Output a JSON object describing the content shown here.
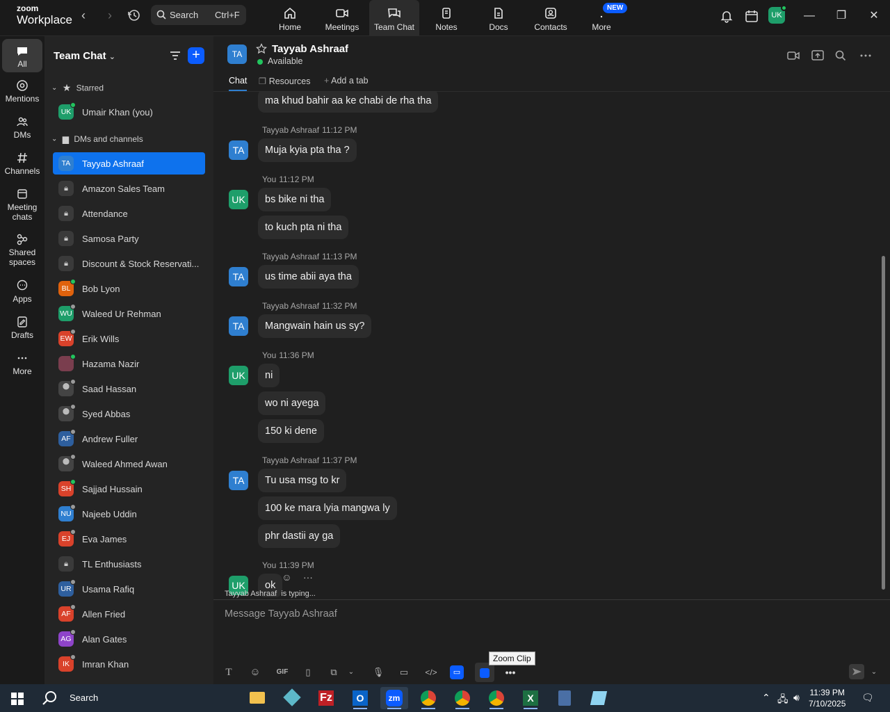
{
  "topbar": {
    "logo_small": "zoom",
    "logo_big": "Workplace",
    "search_label": "Search",
    "search_shortcut": "Ctrl+F",
    "tabs": [
      {
        "label": "Home",
        "icon": "home-icon"
      },
      {
        "label": "Meetings",
        "icon": "video-icon"
      },
      {
        "label": "Team Chat",
        "icon": "chat-icon"
      },
      {
        "label": "Notes",
        "icon": "notes-icon"
      },
      {
        "label": "Docs",
        "icon": "docs-icon"
      },
      {
        "label": "Contacts",
        "icon": "contacts-icon"
      },
      {
        "label": "More",
        "icon": "more-icon",
        "badge": "NEW"
      }
    ],
    "user_initials": "UK"
  },
  "rail": {
    "items": [
      {
        "label": "All"
      },
      {
        "label": "Mentions"
      },
      {
        "label": "DMs"
      },
      {
        "label": "Channels"
      },
      {
        "label": "Meeting chats"
      },
      {
        "label": "Shared spaces"
      },
      {
        "label": "Apps"
      },
      {
        "label": "Drafts"
      },
      {
        "label": "More"
      }
    ]
  },
  "sidebar": {
    "title": "Team Chat",
    "starred_label": "Starred",
    "starred": [
      {
        "initials": "UK",
        "name": "Umair Khan (you)",
        "color": "#1e9e6a",
        "status": "#22c55e"
      }
    ],
    "dms_label": "DMs and channels",
    "items": [
      {
        "initials": "TA",
        "name": "Tayyab Ashraaf",
        "color": "#2f7fd0",
        "status": "",
        "active": true
      },
      {
        "initials": "",
        "name": "Amazon Sales Team",
        "kind": "lock"
      },
      {
        "initials": "",
        "name": "Attendance",
        "kind": "lock"
      },
      {
        "initials": "",
        "name": "Samosa Party",
        "kind": "lock"
      },
      {
        "initials": "",
        "name": "Discount & Stock Reservati...",
        "kind": "lock"
      },
      {
        "initials": "BL",
        "name": "Bob Lyon",
        "color": "#e0620d",
        "status": "#22c55e"
      },
      {
        "initials": "WU",
        "name": "Waleed Ur Rehman",
        "color": "#1e9e6a",
        "status": "#9a9a9a"
      },
      {
        "initials": "EW",
        "name": "Erik Wills",
        "color": "#d9422b",
        "status": "#9a9a9a"
      },
      {
        "initials": "",
        "name": "Hazama Nazir",
        "kind": "photo",
        "color": "#7a3e4e",
        "status": "#22c55e"
      },
      {
        "initials": "",
        "name": "Saad Hassan",
        "kind": "photo",
        "status": "#9a9a9a"
      },
      {
        "initials": "",
        "name": "Syed Abbas",
        "kind": "photo",
        "status": "#9a9a9a"
      },
      {
        "initials": "AF",
        "name": "Andrew Fuller",
        "color": "#2e5f9e",
        "status": "#9a9a9a"
      },
      {
        "initials": "",
        "name": "Waleed Ahmed Awan",
        "kind": "photo",
        "status": "#9a9a9a"
      },
      {
        "initials": "SH",
        "name": "Sajjad Hussain",
        "color": "#d9422b",
        "status": "#22c55e"
      },
      {
        "initials": "NU",
        "name": "Najeeb Uddin",
        "color": "#2f7fd0",
        "status": "#9a9a9a"
      },
      {
        "initials": "EJ",
        "name": "Eva James",
        "color": "#d9422b",
        "status": "#9a9a9a"
      },
      {
        "initials": "",
        "name": "TL Enthusiasts",
        "kind": "lock"
      },
      {
        "initials": "UR",
        "name": "Usama Rafiq",
        "color": "#2e5f9e",
        "status": "#9a9a9a"
      },
      {
        "initials": "AF",
        "name": "Allen Fried",
        "color": "#d9422b",
        "status": "#9a9a9a"
      },
      {
        "initials": "AG",
        "name": "Alan Gates",
        "color": "#8e44c9",
        "status": "#9a9a9a"
      },
      {
        "initials": "IK",
        "name": "Imran Khan",
        "color": "#d9422b",
        "status": "#9a9a9a"
      }
    ]
  },
  "chat": {
    "avatar_initials": "TA",
    "name": "Tayyab Ashraaf",
    "status": "Available",
    "tabs": [
      "Chat",
      "Resources",
      "Add a tab"
    ],
    "messages": [
      {
        "text": "ma khud bahir aa ke chabi de rha tha",
        "sender": "",
        "time": "",
        "avatar": ""
      },
      {
        "text": "Muja kyia pta tha ?",
        "sender": "Tayyab Ashraaf",
        "time": "11:12 PM",
        "avatar": "TA"
      },
      {
        "text": "bs bike ni tha",
        "sender": "You",
        "time": "11:12 PM",
        "avatar": "UK"
      },
      {
        "text": "to kuch pta ni tha",
        "sender": "",
        "time": "",
        "avatar": ""
      },
      {
        "text": "us time abii aya tha",
        "sender": "Tayyab Ashraaf",
        "time": "11:13 PM",
        "avatar": "TA"
      },
      {
        "text": "Mangwain hain us sy?",
        "sender": "Tayyab Ashraaf",
        "time": "11:32 PM",
        "avatar": "TA"
      },
      {
        "text": "ni",
        "sender": "You",
        "time": "11:36 PM",
        "avatar": "UK"
      },
      {
        "text": "wo ni ayega",
        "sender": "",
        "time": "",
        "avatar": ""
      },
      {
        "text": "150 ki dene",
        "sender": "",
        "time": "",
        "avatar": ""
      },
      {
        "text": "Tu usa msg to kr",
        "sender": "Tayyab Ashraaf",
        "time": "11:37 PM",
        "avatar": "TA"
      },
      {
        "text": "100 ke mara lyia mangwa ly",
        "sender": "",
        "time": "",
        "avatar": ""
      },
      {
        "text": "phr dastii ay ga",
        "sender": "",
        "time": "",
        "avatar": ""
      },
      {
        "text": "ok",
        "sender": "You",
        "time": "11:39 PM",
        "avatar": "UK"
      }
    ],
    "typing_name": "Tayyab Ashraaf",
    "typing_suffix": "is typing...",
    "composer_placeholder": "Message Tayyab Ashraaf",
    "gif_label": "GIF",
    "tooltip": "Zoom Clip"
  },
  "taskbar": {
    "search_label": "Search",
    "time": "11:39 PM",
    "date": "7/10/2025"
  }
}
